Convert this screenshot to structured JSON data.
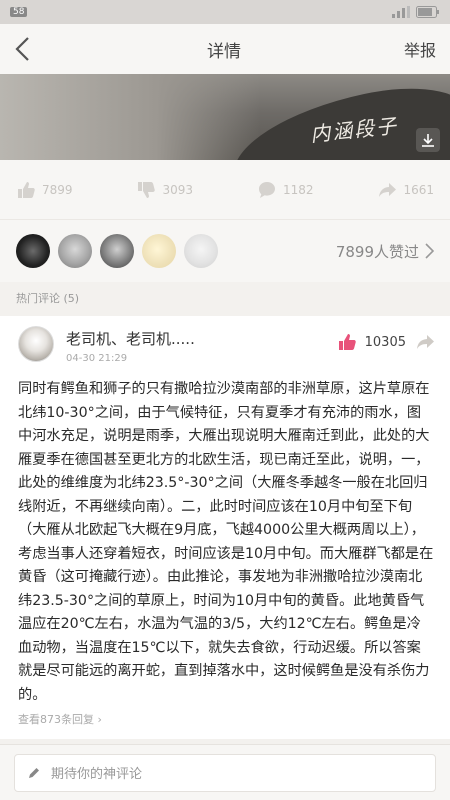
{
  "status": {
    "badge": "58"
  },
  "header": {
    "title": "详情",
    "report_label": "举报"
  },
  "banner": {
    "caption": "内涵段子"
  },
  "action_bar": {
    "likes": "7899",
    "dislikes": "3093",
    "comments": "1182",
    "shares": "1661"
  },
  "likers": {
    "count_label": "7899人赞过"
  },
  "comments_section": {
    "label": "热门评论 (5)"
  },
  "comment": {
    "author": "老司机、老司机.....",
    "time": "04-30 21:29",
    "like_count": "10305",
    "text": "同时有鳄鱼和狮子的只有撒哈拉沙漠南部的非洲草原，这片草原在北纬10-30°之间，由于气候特征，只有夏季才有充沛的雨水，图中河水充足，说明是雨季，大雁出现说明大雁南迁到此，此处的大雁夏季在德国甚至更北方的北欧生活，现已南迁至此，说明，一，此处的维维度为北纬23.5°-30°之间（大雁冬季越冬一般在北回归线附近，不再继续向南）。二，此时时间应该在10月中旬至下旬（大雁从北欧起飞大概在9月底，飞越4000公里大概两周以上），考虑当事人还穿着短衣，时间应该是10月中旬。而大雁群飞都是在黄昏（这可掩藏行迹）。由此推论，事发地为非洲撒哈拉沙漠南北纬23.5-30°之间的草原上，时间为10月中旬的黄昏。此地黄昏气温应在20℃左右，水温为气温的3/5，大约12℃左右。鳄鱼是冷血动物，当温度在15℃以下，就失去食欲，行动迟缓。所以答案就是尽可能远的离开蛇，直到掉落水中，这时候鳄鱼是没有杀伤力的。",
    "view_all": "查看873条回复 ›"
  },
  "input": {
    "placeholder": "期待你的神评论"
  },
  "colors": {
    "like_active": "#e8527a",
    "text_muted": "#999999"
  }
}
